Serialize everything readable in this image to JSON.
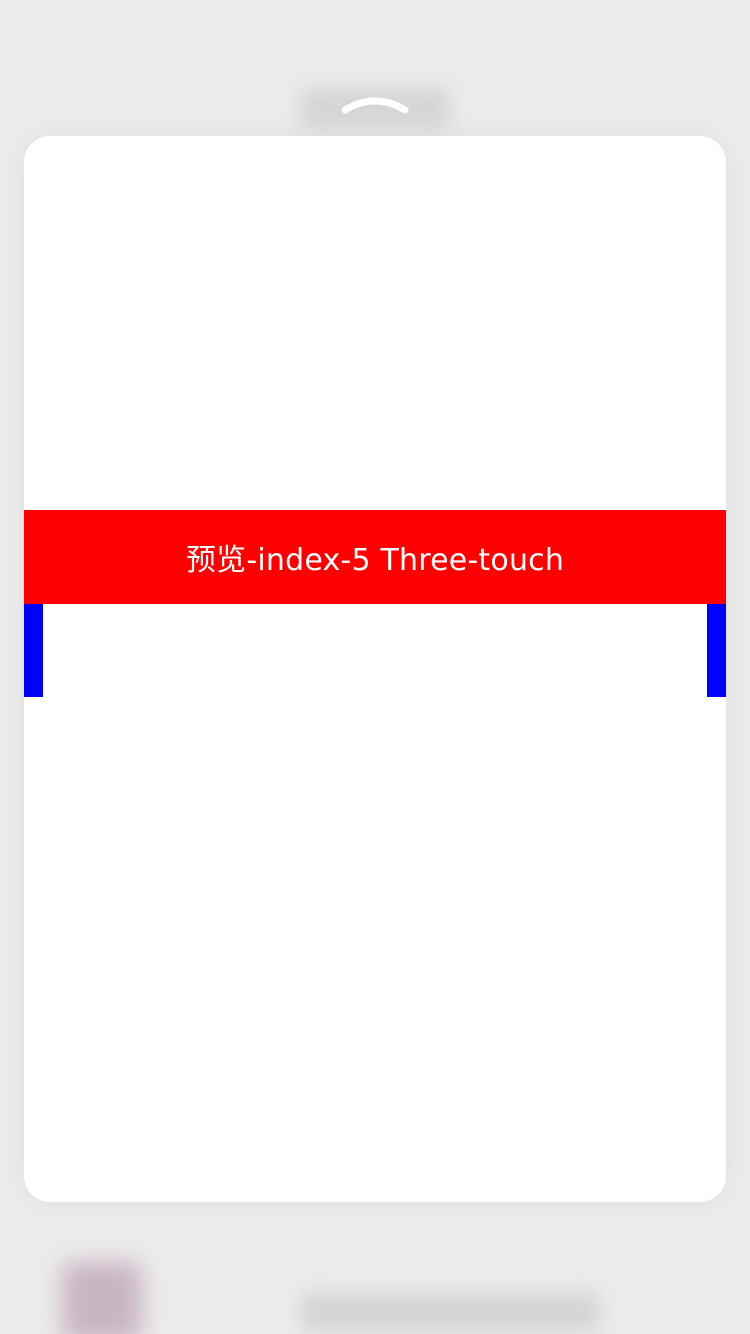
{
  "background": {
    "color": "#ececec"
  },
  "peek": {
    "chevron_icon": "chevron-up-icon",
    "chevron_color": "#ffffff"
  },
  "preview_card": {
    "background": "#ffffff",
    "banner": {
      "text": "预览-index-5 Three-touch",
      "color": "#ff0000",
      "text_color": "#ffffff"
    },
    "side_bars": {
      "color": "#0000ff"
    }
  }
}
